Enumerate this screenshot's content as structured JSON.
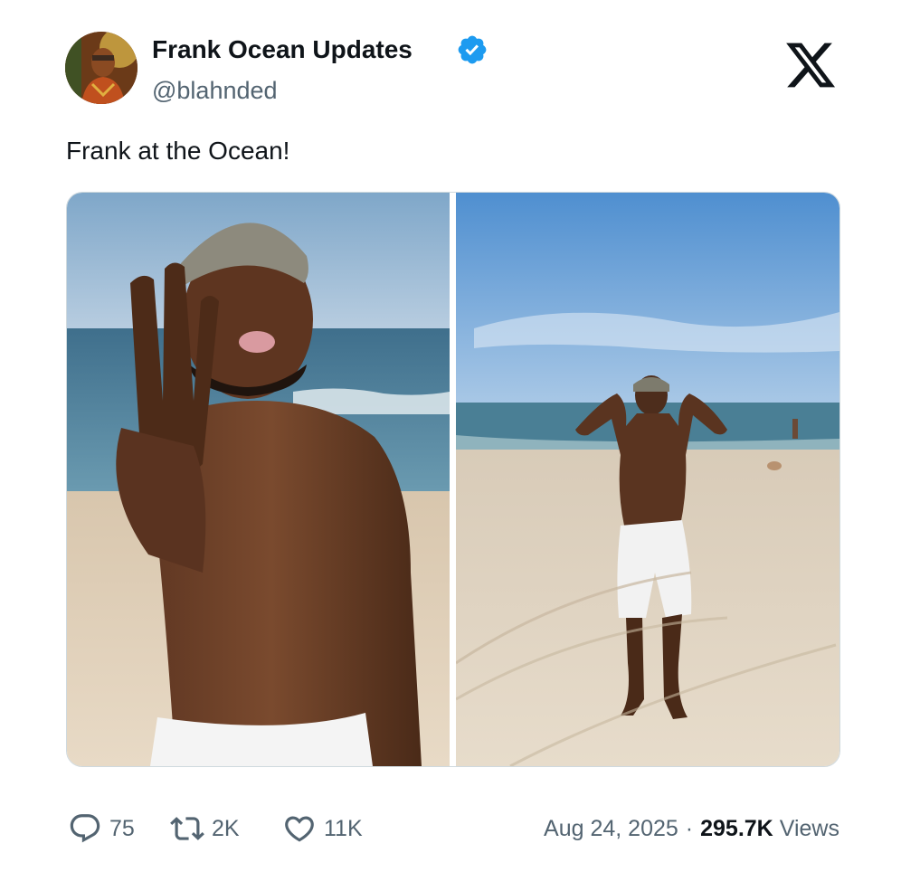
{
  "author": {
    "name": "Frank Ocean Updates",
    "handle": "@blahnded",
    "verified": true,
    "verified_color": "#1d9bf0"
  },
  "tweet": {
    "text": "Frank at the Ocean!",
    "media_count": 2
  },
  "metrics": {
    "replies": "75",
    "retweets": "2K",
    "likes": "11K"
  },
  "meta": {
    "date": "Aug 24, 2025",
    "separator": "·",
    "views_count": "295.7K",
    "views_label": "Views"
  },
  "icons": {
    "reply": "reply-icon",
    "retweet": "retweet-icon",
    "like": "heart-icon",
    "brand": "x-logo-icon",
    "verified": "verified-badge-icon"
  },
  "colors": {
    "text_primary": "#0f1419",
    "text_secondary": "#536471",
    "border": "#cfd9de"
  }
}
